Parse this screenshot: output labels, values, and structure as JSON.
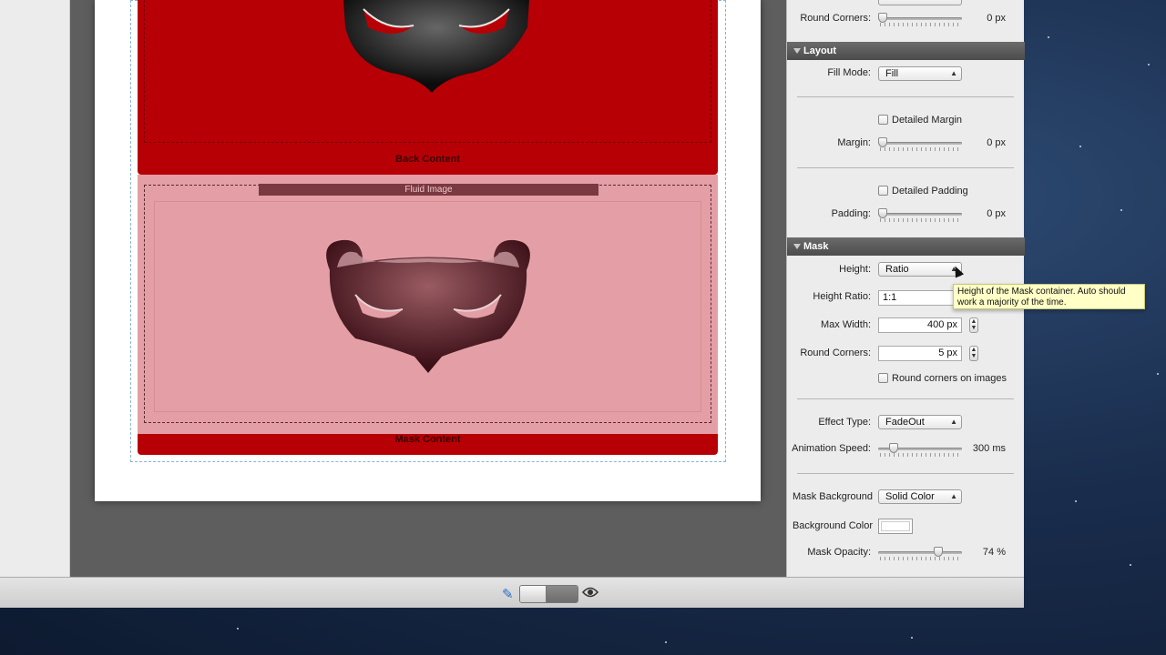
{
  "canvas": {
    "back_content_label": "Back Content",
    "fluid_image_label": "Fluid Image",
    "mask_content_label": "Mask Content"
  },
  "inspector": {
    "top": {
      "round_corners_label": "Round Corners:",
      "round_corners_value": "0 px"
    },
    "layout": {
      "title": "Layout",
      "fill_mode_label": "Fill Mode:",
      "fill_mode_value": "Fill",
      "detailed_margin_label": "Detailed Margin",
      "margin_label": "Margin:",
      "margin_value": "0 px",
      "detailed_padding_label": "Detailed Padding",
      "padding_label": "Padding:",
      "padding_value": "0 px"
    },
    "mask": {
      "title": "Mask",
      "height_label": "Height:",
      "height_value": "Ratio",
      "height_ratio_label": "Height Ratio:",
      "height_ratio_value": "1:1",
      "max_width_label": "Max Width:",
      "max_width_value": "400 px",
      "round_corners_label": "Round Corners:",
      "round_corners_value": "5 px",
      "round_corners_images_label": "Round corners on images",
      "effect_type_label": "Effect Type:",
      "effect_type_value": "FadeOut",
      "animation_speed_label": "Animation Speed:",
      "animation_speed_value": "300 ms",
      "mask_background_label": "Mask Background",
      "mask_background_value": "Solid Color",
      "background_color_label": "Background Color",
      "background_color": "#ffffff",
      "mask_opacity_label": "Mask Opacity:",
      "mask_opacity_value": "74 %"
    }
  },
  "tooltip": {
    "text": "Height of the Mask container. Auto should work a majority of the time."
  },
  "colors": {
    "back_red": "#b70006",
    "mask_pink": "#e49fa6"
  },
  "bottom_bar": {
    "edit_icon": "pencil-icon",
    "preview_icon": "eye-icon"
  }
}
